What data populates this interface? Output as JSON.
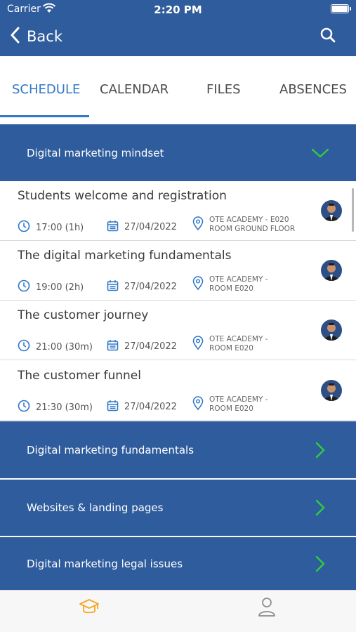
{
  "status_bar": {
    "carrier": "Carrier",
    "time": "2:20 PM"
  },
  "nav": {
    "back_label": "Back",
    "search_icon": "search-icon"
  },
  "tabs": [
    {
      "label": "SCHEDULE",
      "active": true
    },
    {
      "label": "CALENDAR",
      "active": false
    },
    {
      "label": "FILES",
      "active": false
    },
    {
      "label": "ABSENCES",
      "active": false
    }
  ],
  "expanded_section": {
    "title": "Digital marketing mindset",
    "sessions": [
      {
        "title": "Students welcome and registration",
        "time": "17:00 (1h)",
        "date": "27/04/2022",
        "location_line1": "OTE ACADEMY - E020",
        "location_line2": "ROOM GROUND FLOOR"
      },
      {
        "title": "The digital marketing fundamentals",
        "time": "19:00 (2h)",
        "date": "27/04/2022",
        "location_line1": "OTE ACADEMY -",
        "location_line2": "ROOM E020"
      },
      {
        "title": "The customer journey",
        "time": "21:00 (30m)",
        "date": "27/04/2022",
        "location_line1": "OTE ACADEMY -",
        "location_line2": "ROOM E020"
      },
      {
        "title": "The customer funnel",
        "time": "21:30 (30m)",
        "date": "27/04/2022",
        "location_line1": "OTE ACADEMY -",
        "location_line2": "ROOM E020"
      }
    ]
  },
  "collapsed_sections": [
    {
      "title": "Digital marketing fundamentals"
    },
    {
      "title": "Websites & landing pages"
    },
    {
      "title": "Digital marketing legal issues"
    }
  ],
  "colors": {
    "header": "#2f5c9c",
    "accent": "#3178c6",
    "chevron": "#2ecc40",
    "bottom_active": "#f5a623"
  },
  "bottom_nav": [
    {
      "icon": "graduation-cap-icon",
      "active": true
    },
    {
      "icon": "profile-icon",
      "active": false
    }
  ]
}
